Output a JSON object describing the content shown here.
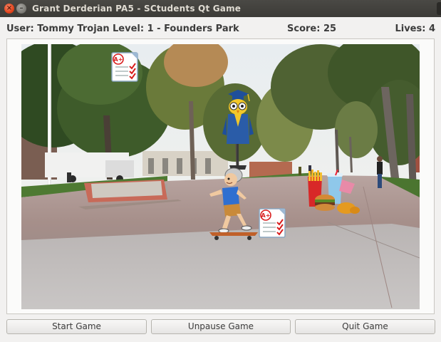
{
  "window": {
    "title": "Grant Derderian PA5 - SCtudents Qt Game",
    "close_glyph": "×",
    "minimize_glyph": "–"
  },
  "hud": {
    "user": "User: Tommy Trojan",
    "level": "Level: 1 - Founders Park",
    "score": "Score: 25",
    "lives": "Lives: 4"
  },
  "buttons": {
    "start": "Start Game",
    "unpause": "Unpause Game",
    "quit": "Quit Game"
  },
  "scene": {
    "background": "campus-walkway-photo",
    "sprites": [
      "grade-a-paper-icon",
      "graduate-owl-enemy",
      "skateboarder-player",
      "grade-a-paper-icon",
      "fast-food-pile-enemy"
    ],
    "grade_label": "A+"
  },
  "colors": {
    "titlebar": "#3c3b37",
    "close_button": "#e2441c",
    "window_bg": "#f2f1f0"
  }
}
